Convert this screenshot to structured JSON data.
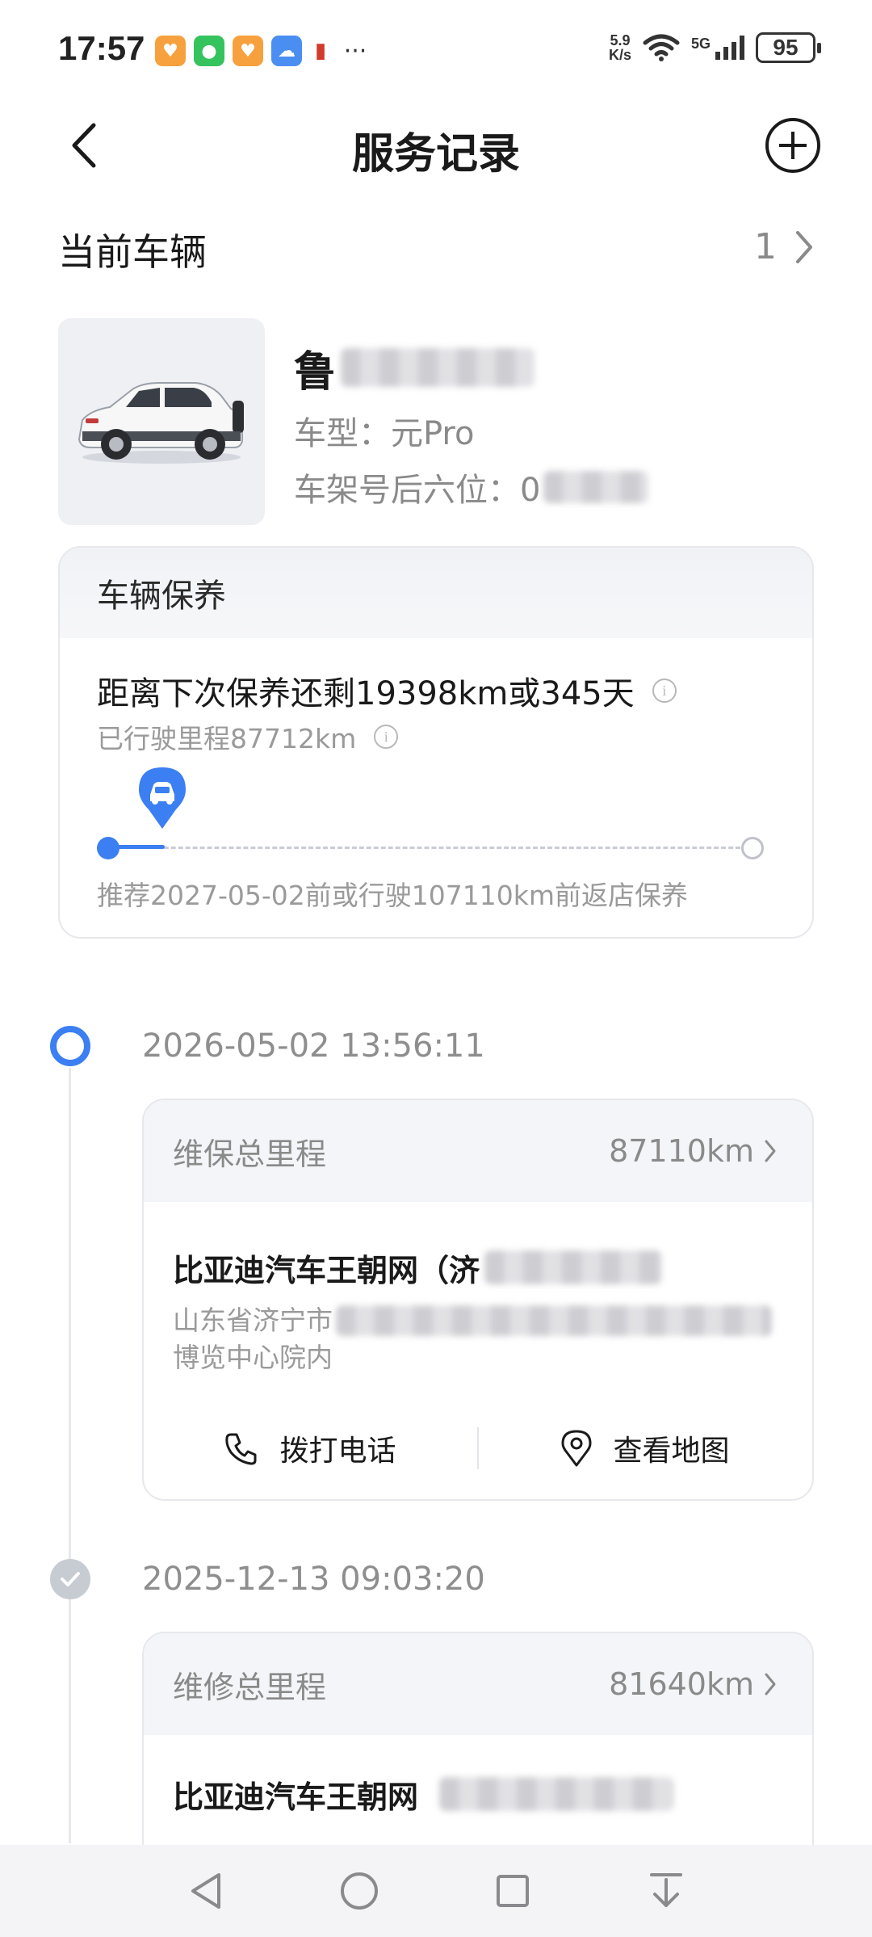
{
  "status_bar": {
    "time": "17:57",
    "net_speed_value": "5.9",
    "net_speed_unit": "K/s",
    "network": "5G",
    "battery": "95"
  },
  "header": {
    "title": "服务记录"
  },
  "vehicle": {
    "section_label": "当前车辆",
    "count": "1",
    "plate_prefix": "鲁",
    "model": "车型：元Pro",
    "vin_label": "车架号后六位：0"
  },
  "maintenance": {
    "title": "车辆保养",
    "remaining": "距离下次保养还剩19398km或345天",
    "mileage": "已行驶里程87712km",
    "recommend": "推荐2027-05-02前或行驶107110km前返店保养",
    "progress": 0.08
  },
  "records": [
    {
      "date": "2026-05-02 13:56:11",
      "label": "维保总里程",
      "value": "87110km",
      "dealer": "比亚迪汽车王朝网（济",
      "address_start": "山东省济宁市",
      "address_end": "博览中心院内",
      "call_label": "拨打电话",
      "map_label": "查看地图"
    },
    {
      "date": "2025-12-13 09:03:20",
      "label": "维修总里程",
      "value": "81640km",
      "dealer": "比亚迪汽车王朝网"
    }
  ],
  "colors": {
    "accent": "#3b7ff3",
    "muted": "#8a8a8a"
  }
}
